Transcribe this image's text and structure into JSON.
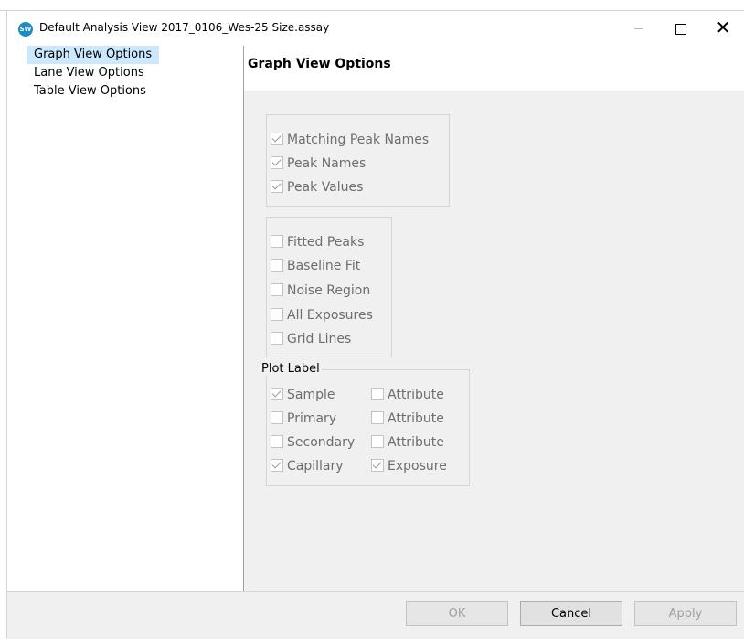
{
  "window": {
    "title": "Default Analysis View 2017_0106_Wes-25 Size.assay",
    "app_icon": "SW",
    "close_glyph": "✕"
  },
  "nav": {
    "items": [
      {
        "label": "Graph View Options",
        "selected": true
      },
      {
        "label": "Lane View Options",
        "selected": false
      },
      {
        "label": "Table View Options",
        "selected": false
      }
    ]
  },
  "section": {
    "title": "Graph View Options"
  },
  "group1": [
    {
      "label": "Matching Peak Names",
      "checked": true
    },
    {
      "label": "Peak Names",
      "checked": true
    },
    {
      "label": "Peak Values",
      "checked": true
    }
  ],
  "group2": [
    {
      "label": "Fitted Peaks",
      "checked": false
    },
    {
      "label": "Baseline Fit",
      "checked": false
    },
    {
      "label": "Noise Region",
      "checked": false
    },
    {
      "label": "All Exposures",
      "checked": false
    },
    {
      "label": "Grid Lines",
      "checked": false
    }
  ],
  "plot_label": {
    "legend": "Plot Label",
    "rows": [
      {
        "left": {
          "label": "Sample",
          "checked": true
        },
        "right": {
          "label": "Attribute",
          "checked": false
        }
      },
      {
        "left": {
          "label": "Primary",
          "checked": false
        },
        "right": {
          "label": "Attribute",
          "checked": false
        }
      },
      {
        "left": {
          "label": "Secondary",
          "checked": false
        },
        "right": {
          "label": "Attribute",
          "checked": false
        }
      },
      {
        "left": {
          "label": "Capillary",
          "checked": true
        },
        "right": {
          "label": "Exposure",
          "checked": true
        }
      }
    ]
  },
  "buttons": {
    "ok": "OK",
    "cancel": "Cancel",
    "apply": "Apply"
  }
}
